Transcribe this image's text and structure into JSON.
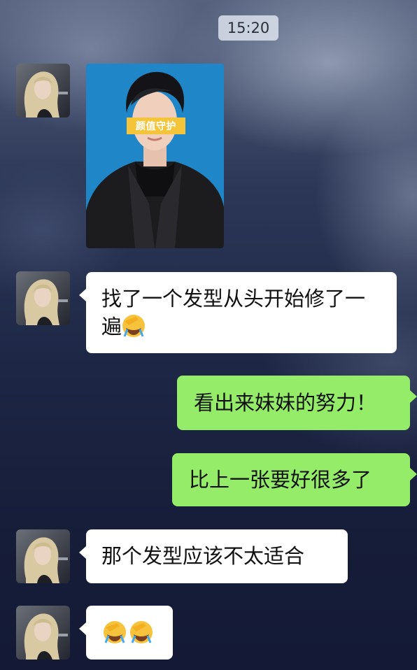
{
  "chat": {
    "timestamp": "15:20",
    "photo_badge": "颜值守护",
    "messages": [
      {
        "side": "left",
        "type": "image",
        "description_icon": "portrait-photo"
      },
      {
        "side": "left",
        "type": "text",
        "text": "找了一个发型从头开始修了一遍",
        "emoji": "facepalm-crying-emoji"
      },
      {
        "side": "right",
        "type": "text",
        "text": "看出来妹妹的努力！"
      },
      {
        "side": "right",
        "type": "text",
        "text": "比上一张要好很多了"
      },
      {
        "side": "left",
        "type": "text",
        "text": "那个发型应该不太适合"
      },
      {
        "side": "left",
        "type": "emoji_only",
        "emoji": [
          "facepalm-crying-emoji",
          "facepalm-crying-emoji"
        ]
      }
    ]
  },
  "colors": {
    "outgoing_bubble": "#95ec69",
    "incoming_bubble": "#ffffff",
    "photo_background": "#1f86c7",
    "badge": "#f4c53a"
  }
}
